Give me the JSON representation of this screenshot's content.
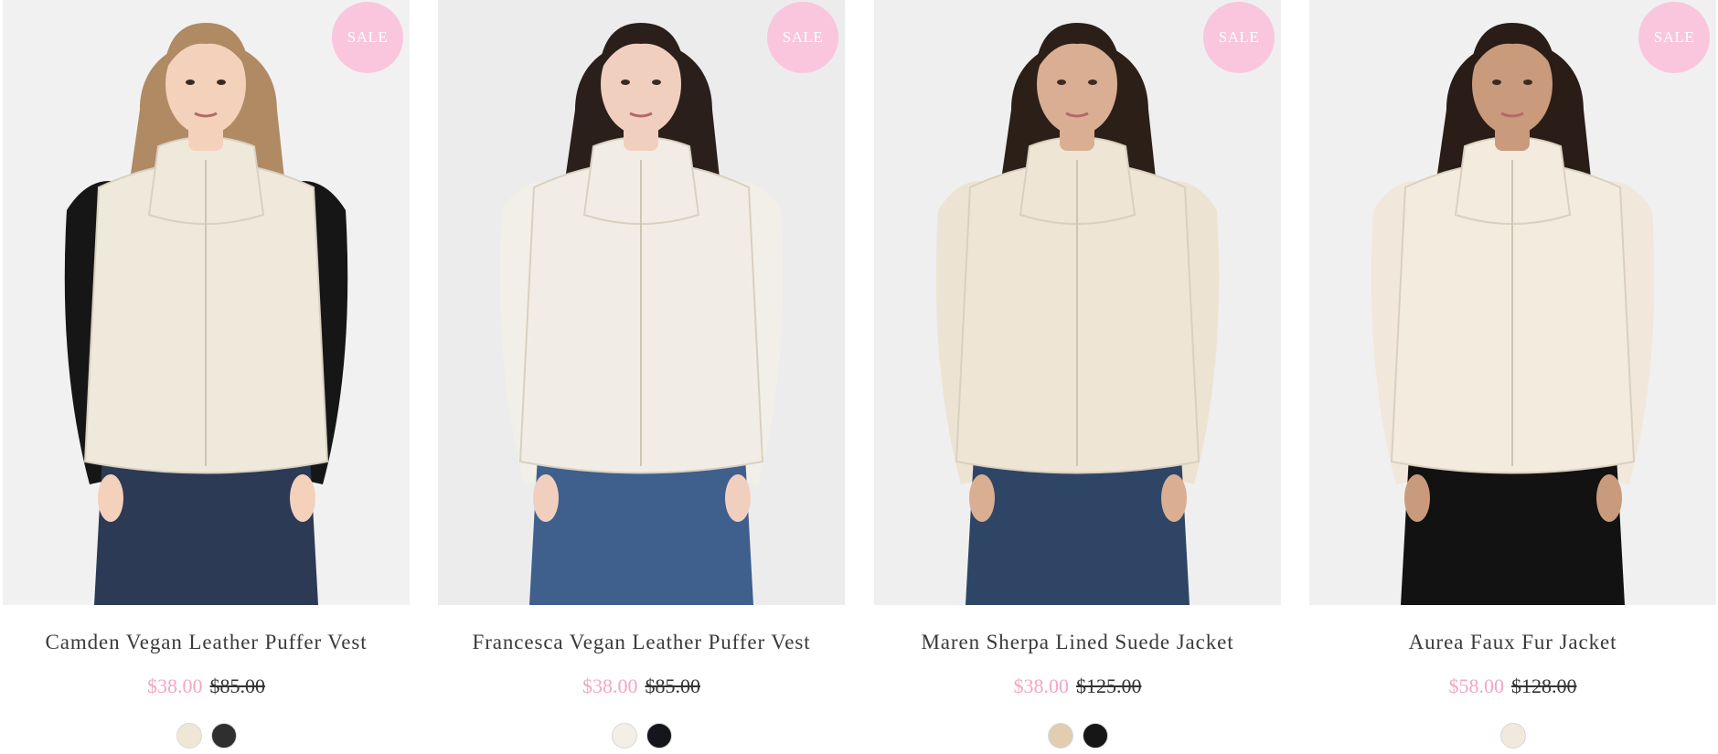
{
  "products": [
    {
      "badge": "SALE",
      "title": "Camden Vegan Leather Puffer Vest",
      "sale_price": "$38.00",
      "original_price": "$85.00",
      "swatches": [
        {
          "name": "cream",
          "color": "#efe7d6"
        },
        {
          "name": "black",
          "color": "#2f2f2f"
        }
      ],
      "image": {
        "background": "#f1f1f2",
        "hair": "#b08a62",
        "skin": "#f3d1bb",
        "sleeves": "#161616",
        "jacket": "#efe9dc",
        "pants": "#2c3a55"
      }
    },
    {
      "badge": "SALE",
      "title": "Francesca Vegan Leather Puffer Vest",
      "sale_price": "$38.00",
      "original_price": "$85.00",
      "swatches": [
        {
          "name": "cream",
          "color": "#f3eee6"
        },
        {
          "name": "black",
          "color": "#14161c"
        }
      ],
      "image": {
        "background": "#ececed",
        "hair": "#2a1f1a",
        "skin": "#f1cfbe",
        "sleeves": "#f2efe9",
        "jacket": "#f1ede6",
        "pants": "#3f5f8c"
      }
    },
    {
      "badge": "SALE",
      "title": "Maren Sherpa Lined Suede Jacket",
      "sale_price": "$38.00",
      "original_price": "$125.00",
      "swatches": [
        {
          "name": "tan",
          "color": "#e2cdb0"
        },
        {
          "name": "black",
          "color": "#161616"
        }
      ],
      "image": {
        "background": "#efeff0",
        "hair": "#2b1f18",
        "skin": "#d9ae92",
        "sleeves": "#ede3d3",
        "jacket": "#efe5d4",
        "pants": "#2f4566"
      }
    },
    {
      "badge": "SALE",
      "title": "Aurea Faux Fur Jacket",
      "sale_price": "$58.00",
      "original_price": "$128.00",
      "swatches": [
        {
          "name": "cream",
          "color": "#f1e9dc"
        }
      ],
      "image": {
        "background": "#f0f0f1",
        "hair": "#2a1c16",
        "skin": "#c99a7b",
        "sleeves": "#f1e7da",
        "jacket": "#f3ebde",
        "pants": "#121212"
      }
    }
  ]
}
